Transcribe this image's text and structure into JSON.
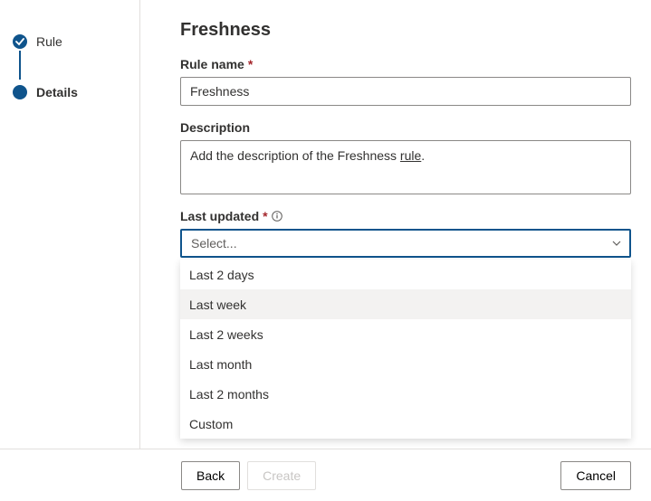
{
  "sidebar": {
    "step1_label": "Rule",
    "step2_label": "Details"
  },
  "main": {
    "title": "Freshness",
    "rule_name_label": "Rule name",
    "rule_name_value": "Freshness",
    "description_label": "Description",
    "description_prefix": "Add the description of the Freshness ",
    "description_link": "rule",
    "description_suffix": ".",
    "last_updated_label": "Last updated",
    "dropdown_placeholder": "Select...",
    "options": [
      "Last 2 days",
      "Last week",
      "Last 2 weeks",
      "Last month",
      "Last 2 months",
      "Custom"
    ],
    "hover_index": 1
  },
  "footer": {
    "back": "Back",
    "create": "Create",
    "cancel": "Cancel"
  }
}
